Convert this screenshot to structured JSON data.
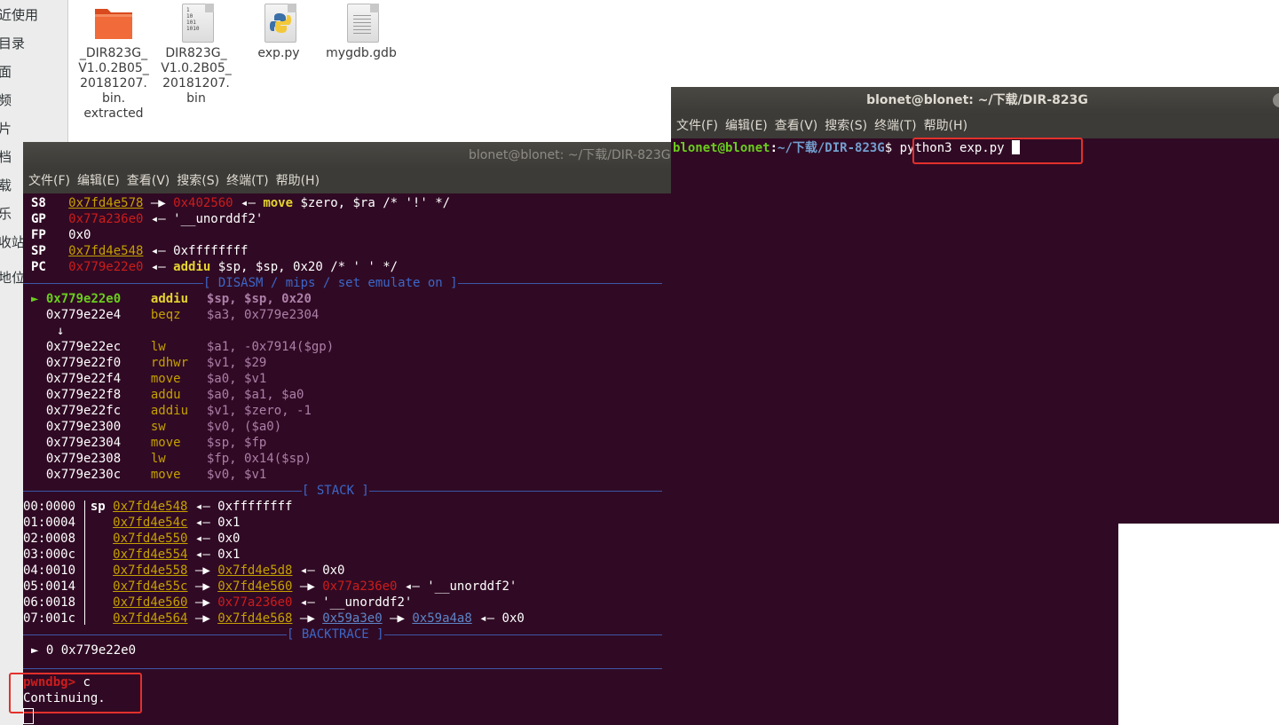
{
  "sidebar": {
    "items": [
      "近使用",
      "目录",
      "面",
      "频",
      "片",
      "档",
      "载",
      "乐",
      "收站",
      "地位"
    ]
  },
  "files": [
    {
      "name": "_DIR823G_\nV1.0.2B05_\n20181207.\nbin.\nextracted",
      "icon": "folder-icon"
    },
    {
      "name": "DIR823G_\nV1.0.2B05_\n20181207.\nbin",
      "icon": "binary-file-icon",
      "icon_text": "1\n10\n101\n1010"
    },
    {
      "name": "exp.py",
      "icon": "python-file-icon"
    },
    {
      "name": "mygdb.gdb",
      "icon": "text-file-icon"
    }
  ],
  "term1": {
    "title": "blonet@blonet: ~/下载/DIR-823G",
    "menu": [
      "文件(F)",
      "编辑(E)",
      "查看(V)",
      "搜索(S)",
      "终端(T)",
      "帮助(H)"
    ],
    "registers": [
      {
        "name": "S8",
        "addr": "0x7fd4e578",
        "arrow": " —▶ ",
        "target": "0x402560",
        "rest": " ◂— ",
        "instr": "move",
        "args": " $zero, $ra /* '!' */"
      },
      {
        "name": "GP",
        "addr": "0x77a236e0",
        "rest": " ◂— '__unorddf2'"
      },
      {
        "name": "FP",
        "value": "0x0"
      },
      {
        "name": "SP",
        "addr": "0x7fd4e548",
        "rest": " ◂— 0xffffffff"
      },
      {
        "name": "PC",
        "addr": "0x779e22e0",
        "rest": " ◂— ",
        "instr": "addiu",
        "args": " $sp, $sp, 0x20 /* ' ' */"
      }
    ],
    "disasm_header": "[ DISASM / mips / set emulate on ]",
    "disasm": [
      {
        "marker": "►",
        "addr": "0x779e22e0",
        "op": "addiu",
        "args": "$sp, $sp, 0x20"
      },
      {
        "addr": "0x779e22e4",
        "op": "beqz",
        "args": "$a3, 0x779e2304"
      },
      {
        "arrow": "↓"
      },
      {
        "addr": "0x779e22ec",
        "op": "lw",
        "args": "$a1, -0x7914($gp)"
      },
      {
        "addr": "0x779e22f0",
        "op": "rdhwr",
        "args": "$v1, $29"
      },
      {
        "addr": "0x779e22f4",
        "op": "move",
        "args": "$a0, $v1"
      },
      {
        "addr": "0x779e22f8",
        "op": "addu",
        "args": "$a0, $a1, $a0"
      },
      {
        "addr": "0x779e22fc",
        "op": "addiu",
        "args": "$v1, $zero, -1"
      },
      {
        "addr": "0x779e2300",
        "op": "sw",
        "args": "$v0, ($a0)"
      },
      {
        "addr": "0x779e2304",
        "op": "move",
        "args": "$sp, $fp"
      },
      {
        "addr": "0x779e2308",
        "op": "lw",
        "args": "$fp, 0x14($sp)"
      },
      {
        "addr": "0x779e230c",
        "op": "move",
        "args": "$v0, $v1"
      }
    ],
    "stack_header": "[ STACK ]",
    "stack": [
      {
        "off": "00:0000",
        "sp": "sp",
        "addr": "0x7fd4e548",
        "rest": [
          {
            "t": " ◂— 0xffffffff",
            "c": "w"
          }
        ]
      },
      {
        "off": "01:0004",
        "addr": "0x7fd4e54c",
        "rest": [
          {
            "t": " ◂— 0x1",
            "c": "w"
          }
        ]
      },
      {
        "off": "02:0008",
        "addr": "0x7fd4e550",
        "rest": [
          {
            "t": " ◂— 0x0",
            "c": "w"
          }
        ]
      },
      {
        "off": "03:000c",
        "addr": "0x7fd4e554",
        "rest": [
          {
            "t": " ◂— 0x1",
            "c": "w"
          }
        ]
      },
      {
        "off": "04:0010",
        "addr": "0x7fd4e558",
        "rest": [
          {
            "t": " —▶ ",
            "c": "w"
          },
          {
            "t": "0x7fd4e5d8",
            "c": "yel"
          },
          {
            "t": " ◂— 0x0",
            "c": "w"
          }
        ]
      },
      {
        "off": "05:0014",
        "addr": "0x7fd4e55c",
        "rest": [
          {
            "t": " —▶ ",
            "c": "w"
          },
          {
            "t": "0x7fd4e560",
            "c": "yel"
          },
          {
            "t": " —▶ ",
            "c": "w"
          },
          {
            "t": "0x77a236e0",
            "c": "red"
          },
          {
            "t": " ◂— '__unorddf2'",
            "c": "w"
          }
        ]
      },
      {
        "off": "06:0018",
        "addr": "0x7fd4e560",
        "rest": [
          {
            "t": " —▶ ",
            "c": "w"
          },
          {
            "t": "0x77a236e0",
            "c": "red"
          },
          {
            "t": " ◂— '__unorddf2'",
            "c": "w"
          }
        ]
      },
      {
        "off": "07:001c",
        "addr": "0x7fd4e564",
        "rest": [
          {
            "t": " —▶ ",
            "c": "w"
          },
          {
            "t": "0x7fd4e568",
            "c": "yel"
          },
          {
            "t": " —▶ ",
            "c": "w"
          },
          {
            "t": "0x59a3e0",
            "c": "bluu"
          },
          {
            "t": " —▶ ",
            "c": "w"
          },
          {
            "t": "0x59a4a8",
            "c": "bluu"
          },
          {
            "t": " ◂— 0x0",
            "c": "w"
          }
        ]
      }
    ],
    "backtrace_header": "[ BACKTRACE ]",
    "backtrace": "► 0 0x779e22e0",
    "prompt": "pwndbg>",
    "command": " c",
    "output": "Continuing."
  },
  "term2": {
    "title": "blonet@blonet: ~/下载/DIR-823G",
    "menu": [
      "文件(F)",
      "编辑(E)",
      "查看(V)",
      "搜索(S)",
      "终端(T)",
      "帮助(H)"
    ],
    "user_host": "blonet@blonet",
    "colon": ":",
    "path": "~/下载/DIR-823G",
    "dollar": "$ ",
    "command": "python3 exp.py "
  }
}
